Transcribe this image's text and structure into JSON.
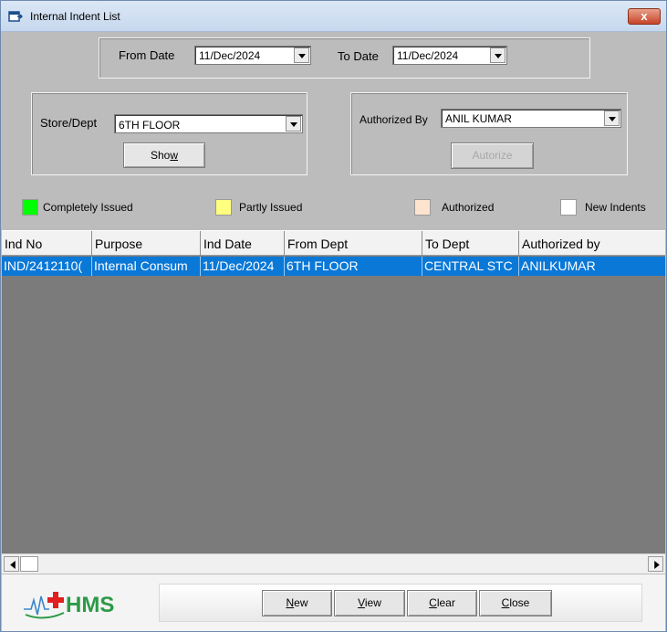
{
  "window": {
    "title": "Internal Indent List",
    "close_label": "x"
  },
  "dates": {
    "from_label": "From Date",
    "from_value": "11/Dec/2024",
    "to_label": "To Date",
    "to_value": "11/Dec/2024"
  },
  "store": {
    "label": "Store/Dept",
    "value": "6TH FLOOR",
    "show_prefix": "Sho",
    "show_accel": "w"
  },
  "auth": {
    "label": "Authorized By",
    "value": "ANIL  KUMAR",
    "autorize_label": "Autorize"
  },
  "legend": [
    {
      "label": "Completely Issued",
      "color": "#00ff00"
    },
    {
      "label": "Partly Issued",
      "color": "#ffff80"
    },
    {
      "label": "Authorized",
      "color": "#fde4cf"
    },
    {
      "label": "New Indents",
      "color": "#ffffff"
    }
  ],
  "grid": {
    "columns": [
      "Ind   No",
      "Purpose",
      "Ind   Date",
      "From Dept",
      "To Dept",
      "Authorized by"
    ],
    "rows": [
      [
        "IND/2412110(",
        "Internal Consum",
        "11/Dec/2024",
        "6TH FLOOR",
        "CENTRAL STC",
        "ANILKUMAR"
      ]
    ],
    "row_color": "#0a78d7"
  },
  "footer": {
    "logo_text": "HMS",
    "buttons": [
      {
        "accel": "N",
        "rest": "ew"
      },
      {
        "accel": "V",
        "rest": "iew"
      },
      {
        "accel": "C",
        "rest": "lear"
      },
      {
        "accel": "C",
        "rest": "lose"
      }
    ]
  }
}
